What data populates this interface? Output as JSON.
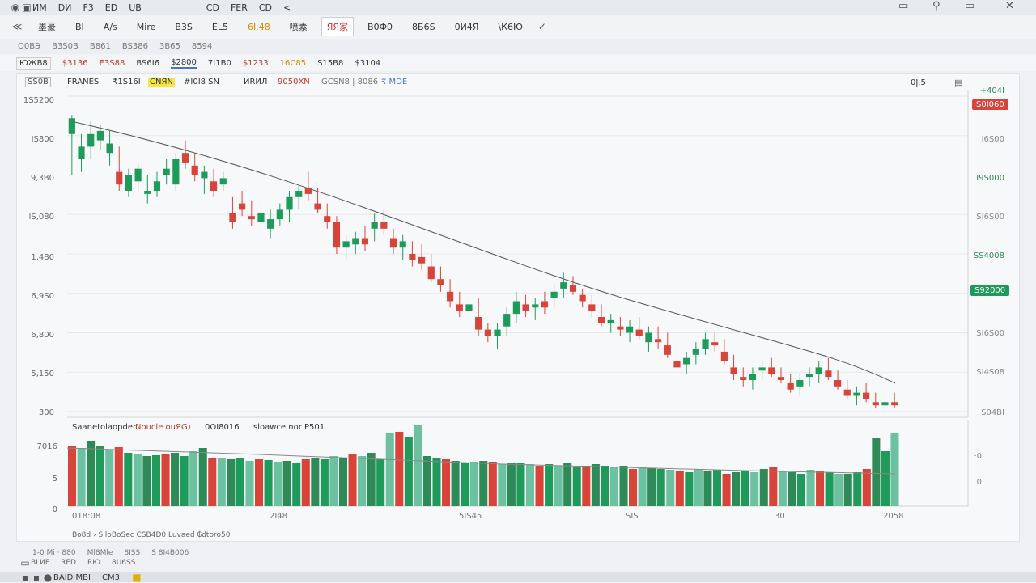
{
  "titlebar": {
    "items": [
      "ИМ",
      "DИ",
      "F3",
      "ЕD",
      "UB"
    ],
    "tabs": [
      "CD",
      "FER",
      "CD",
      "<"
    ]
  },
  "toolbar": {
    "items": [
      "墨豪",
      "BI",
      "A/s",
      "Mire",
      "B3S",
      "EL5",
      "6I.48",
      "喷素",
      "ЯЯ家",
      "B0Ф0",
      "8Б6S",
      "0И4Я",
      "\\К6Ю"
    ],
    "selected": "ЯЯ家"
  },
  "row2": {
    "items": [
      "O0BЭ",
      "B3S0B",
      "B861",
      "BS386",
      "3B65",
      "8594"
    ]
  },
  "quotes": {
    "items": [
      {
        "text": "ЮЖB8",
        "color": "dark"
      },
      {
        "text": "$3136",
        "color": "red"
      },
      {
        "text": "E3S88",
        "color": "red"
      },
      {
        "text": "BS6I6",
        "color": "dark"
      },
      {
        "text": "$2800",
        "color": "dark"
      },
      {
        "text": "7I1B0",
        "color": "dark"
      },
      {
        "text": "$1233",
        "color": "red"
      },
      {
        "text": "16C85",
        "color": "orange"
      },
      {
        "text": "S15B8",
        "color": "dark"
      },
      {
        "text": "$3104",
        "color": "dark"
      }
    ]
  },
  "legend": {
    "box": "SS0B",
    "name": "FRANES",
    "a": "₹1S16I",
    "b": "CNЯN",
    "c": "#I0I8 SN",
    "d": "ИRИЛ",
    "e": "9050XN",
    "f": "GCSN8 | 8086",
    "g": "₹ MDE",
    "flag": "0ǀ.5"
  },
  "chart_data": {
    "type": "candlestick",
    "y_axis_labels": [
      "1S5200",
      "IS800",
      "9,3B0",
      "IS,080",
      "1,480",
      "6,9S0",
      "6,800",
      "5,150",
      "300"
    ],
    "right_axis_labels": [
      "+404I",
      "I6S00",
      "I9S000",
      "SI6S00",
      "SS4008",
      "SI6S00",
      "SI4S08",
      "S04BI"
    ],
    "right_badge_top": "S0I060",
    "right_badge_mid": "S92000",
    "y_range": [
      0,
      100
    ],
    "trend_start": 92,
    "trend_end": 9,
    "candles": [
      [
        88,
        94,
        75,
        93
      ],
      [
        80,
        88,
        76,
        84
      ],
      [
        84,
        92,
        80,
        88
      ],
      [
        86,
        91,
        83,
        89
      ],
      [
        82,
        89,
        78,
        85
      ],
      [
        76,
        84,
        70,
        72
      ],
      [
        70,
        77,
        68,
        75
      ],
      [
        73,
        79,
        70,
        77
      ],
      [
        69,
        75,
        66,
        70
      ],
      [
        70,
        76,
        68,
        73
      ],
      [
        75,
        80,
        72,
        77
      ],
      [
        72,
        82,
        70,
        80
      ],
      [
        82,
        86,
        77,
        79
      ],
      [
        78,
        82,
        73,
        75
      ],
      [
        74,
        78,
        69,
        76
      ],
      [
        73,
        77,
        68,
        70
      ],
      [
        72,
        76,
        70,
        74
      ],
      [
        63,
        68,
        58,
        60
      ],
      [
        66,
        70,
        62,
        64
      ],
      [
        62,
        67,
        59,
        61
      ],
      [
        60,
        66,
        57,
        63
      ],
      [
        58,
        64,
        55,
        61
      ],
      [
        61,
        66,
        59,
        64
      ],
      [
        64,
        70,
        60,
        68
      ],
      [
        68,
        72,
        64,
        70
      ],
      [
        71,
        76,
        67,
        69
      ],
      [
        66,
        71,
        63,
        64
      ],
      [
        62,
        66,
        58,
        60
      ],
      [
        60,
        62,
        50,
        52
      ],
      [
        52,
        56,
        48,
        54
      ],
      [
        53,
        57,
        50,
        55
      ],
      [
        55,
        59,
        51,
        53
      ],
      [
        58,
        63,
        54,
        60
      ],
      [
        60,
        64,
        56,
        58
      ],
      [
        55,
        58,
        50,
        52
      ],
      [
        52,
        56,
        48,
        54
      ],
      [
        50,
        54,
        46,
        48
      ],
      [
        49,
        53,
        45,
        47
      ],
      [
        46,
        50,
        41,
        42
      ],
      [
        42,
        46,
        38,
        40
      ],
      [
        38,
        42,
        33,
        35
      ],
      [
        34,
        38,
        30,
        32
      ],
      [
        32,
        36,
        29,
        34
      ],
      [
        30,
        36,
        24,
        26
      ],
      [
        26,
        28,
        22,
        24
      ],
      [
        24,
        28,
        20,
        26
      ],
      [
        27,
        33,
        24,
        31
      ],
      [
        31,
        38,
        28,
        35
      ],
      [
        34,
        37,
        30,
        32
      ],
      [
        33,
        36,
        29,
        34
      ],
      [
        35,
        38,
        31,
        33
      ],
      [
        36,
        40,
        33,
        38
      ],
      [
        39,
        44,
        36,
        41
      ],
      [
        40,
        43,
        37,
        38
      ],
      [
        37,
        39,
        33,
        35
      ],
      [
        34,
        37,
        30,
        32
      ],
      [
        30,
        34,
        27,
        28
      ],
      [
        28,
        31,
        25,
        29
      ],
      [
        27,
        30,
        24,
        26
      ],
      [
        25,
        29,
        22,
        27
      ],
      [
        26,
        30,
        23,
        24
      ],
      [
        22,
        27,
        19,
        25
      ],
      [
        23,
        27,
        20,
        22
      ],
      [
        21,
        25,
        17,
        18
      ],
      [
        16,
        21,
        13,
        14
      ],
      [
        15,
        19,
        12,
        17
      ],
      [
        18,
        22,
        15,
        20
      ],
      [
        20,
        25,
        18,
        23
      ],
      [
        22,
        25,
        19,
        21
      ],
      [
        19,
        23,
        15,
        16
      ],
      [
        14,
        18,
        10,
        12
      ],
      [
        11,
        14,
        8,
        10
      ],
      [
        10,
        14,
        7,
        12
      ],
      [
        13,
        16,
        10,
        14
      ],
      [
        14,
        17,
        11,
        12
      ],
      [
        11,
        14,
        9,
        10
      ],
      [
        9,
        12,
        6,
        7
      ],
      [
        8,
        12,
        5,
        10
      ],
      [
        11,
        14,
        8,
        12
      ],
      [
        12,
        16,
        9,
        14
      ],
      [
        13,
        17,
        10,
        11
      ],
      [
        10,
        13,
        7,
        8
      ],
      [
        7,
        10,
        4,
        5
      ],
      [
        5,
        8,
        2,
        6
      ],
      [
        6,
        9,
        3,
        4
      ],
      [
        3,
        6,
        1,
        2
      ],
      [
        2,
        5,
        0,
        3
      ],
      [
        3,
        6,
        1,
        2
      ]
    ],
    "volume": {
      "title": "Saanetolaopder",
      "note": "Noucle оuЯG)",
      "c": "0ОІ8016",
      "d": "sloawce nor P501",
      "y_axis_labels": [
        "7016",
        "5",
        "0"
      ],
      "right_axis_labels": [
        "·0",
        "0"
      ],
      "x_axis_labels": [
        "018:08",
        "2І48",
        "5IS45",
        "SIS",
        "30",
        "2058"
      ],
      "values": [
        75,
        72,
        80,
        74,
        70,
        73,
        66,
        64,
        62,
        63,
        64,
        66,
        62,
        68,
        72,
        60,
        60,
        58,
        60,
        56,
        58,
        57,
        55,
        56,
        54,
        58,
        60,
        58,
        62,
        60,
        64,
        62,
        66,
        58,
        90,
        92,
        86,
        100,
        62,
        60,
        58,
        56,
        54,
        55,
        56,
        55,
        52,
        53,
        54,
        52,
        50,
        52,
        50,
        53,
        48,
        50,
        52,
        50,
        48,
        50,
        46,
        48,
        47,
        46,
        45,
        44,
        42,
        46,
        44,
        45,
        40,
        42,
        44,
        42,
        46,
        48,
        44,
        42,
        40,
        45,
        44,
        42,
        40,
        40,
        42,
        46,
        84,
        68,
        90
      ]
    }
  },
  "statusbar": {
    "a": "Bo8d › SIloBoSec CSB4D0 Luvaed ₲dtoro50",
    "b": "1-0 Mi · 880",
    "c": "Ml8Mle",
    "d": "8ӀSS",
    "e": "S 8I4B006"
  },
  "statusbar2": {
    "a": "BLИF",
    "b": "RED",
    "c": "RЮ",
    "d": "8U6SS"
  },
  "taskbar": {
    "a": "BAID MBI",
    "b": "CM3"
  },
  "window_icons": [
    "▭",
    "⚲",
    "▭",
    "✕"
  ]
}
